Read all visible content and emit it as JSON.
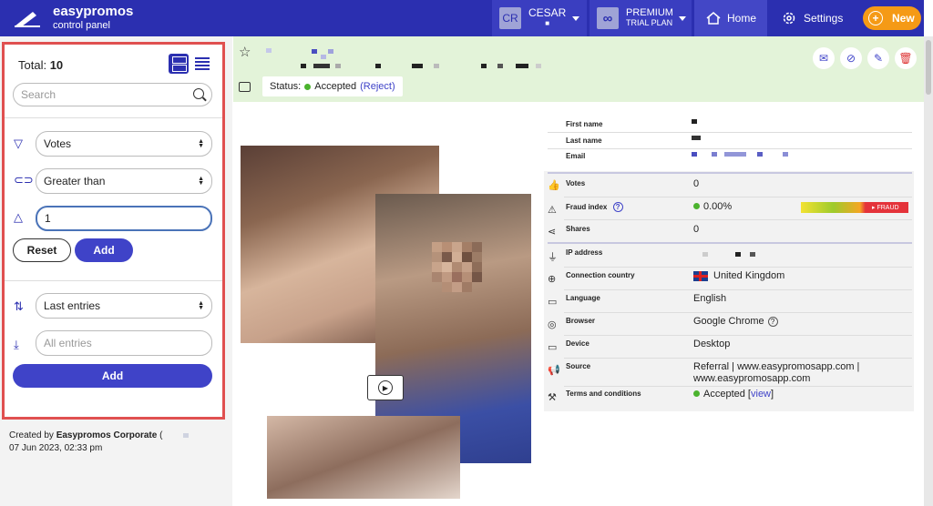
{
  "brand": {
    "name": "easypromos",
    "sub": "control panel"
  },
  "account": {
    "initials": "CR",
    "name": "CESAR",
    "sub": "■"
  },
  "plan": {
    "name": "PREMIUM",
    "sub": "TRIAL PLAN"
  },
  "nav": {
    "home": "Home",
    "settings": "Settings",
    "new": "New"
  },
  "filters": {
    "total_label": "Total:",
    "total_value": "10",
    "search_placeholder": "Search",
    "field": "Votes",
    "operator": "Greater than",
    "value": "1",
    "reset": "Reset",
    "add": "Add",
    "order": "Last entries",
    "limit_placeholder": "All entries",
    "add2": "Add"
  },
  "created": {
    "prefix": "Created by",
    "author": "Easypromos Corporate",
    "suffix": "(",
    "date": "07 Jun 2023, 02:33 pm"
  },
  "status": {
    "label": "Status:",
    "value": "Accepted",
    "reject": "(Reject)"
  },
  "info": {
    "first_name_label": "First name",
    "last_name_label": "Last name",
    "email_label": "Email",
    "votes_label": "Votes",
    "votes": "0",
    "fraud_label": "Fraud index",
    "fraud": "0.00%",
    "fraud_tag": "FRAUD",
    "shares_label": "Shares",
    "shares": "0",
    "ip_label": "IP address",
    "country_label": "Connection country",
    "country": "United Kingdom",
    "language_label": "Language",
    "language": "English",
    "browser_label": "Browser",
    "browser": "Google Chrome",
    "device_label": "Device",
    "device": "Desktop",
    "source_label": "Source",
    "source_line1": "Referral | www.easypromosapp.com |",
    "source_line2": "www.easypromosapp.com",
    "terms_label": "Terms and conditions",
    "terms": "Accepted",
    "terms_link": "view"
  }
}
